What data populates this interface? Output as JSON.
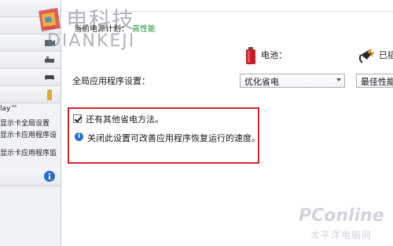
{
  "sidebar": {
    "text_lines": [
      "lay™",
      "显示卡全局设置",
      "显示卡应用程序设",
      "显示卡应用程序监"
    ]
  },
  "power_plan": {
    "label": "当前电源计划：",
    "value": "高性能",
    "value_color": "#1f8f3a"
  },
  "power_sources": {
    "battery_label": "电池：",
    "plugged_label": "已插"
  },
  "global_settings": {
    "label": "全局应用程序设置：",
    "battery_selection": "优化省电",
    "plugged_selection": "最佳性能"
  },
  "power_saving": {
    "checkbox_label": "还有其他省电方法。",
    "checked": true,
    "info_text": "关闭此设置可改善应用程序恢复运行的速度。"
  },
  "colors": {
    "highlight_border": "#d2242b",
    "info_icon": "#2b6cc6"
  },
  "watermarks": {
    "cn": "电科技",
    "en": "DIANKEJI",
    "pconline": "PConline",
    "pconline_sub": "太平洋电脑网"
  }
}
